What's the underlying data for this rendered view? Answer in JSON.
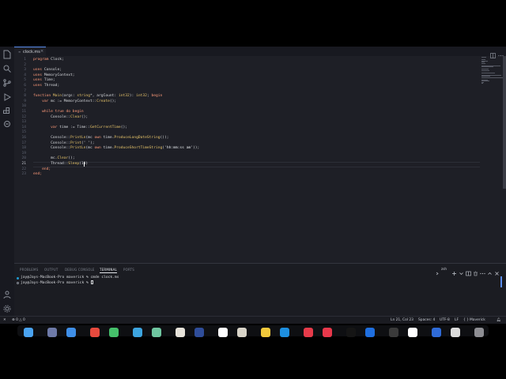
{
  "editor_tab": {
    "icon": "file-icon",
    "label": "clock.ms",
    "close": "×"
  },
  "code": {
    "line_numbers": [
      "1",
      "2",
      "3",
      "4",
      "5",
      "6",
      "7",
      "8",
      "9",
      "10",
      "11",
      "12",
      "13",
      "14",
      "15",
      "16",
      "17",
      "18",
      "19",
      "20",
      "21",
      "22",
      "23"
    ],
    "current_line": 21,
    "lines": [
      [
        {
          "t": "program ",
          "c": "kw"
        },
        {
          "t": "Clock;",
          "c": "pl"
        }
      ],
      [],
      [
        {
          "t": "uses ",
          "c": "kw"
        },
        {
          "t": "Console;",
          "c": "pl"
        }
      ],
      [
        {
          "t": "uses ",
          "c": "kw"
        },
        {
          "t": "MemoryContext;",
          "c": "pl"
        }
      ],
      [
        {
          "t": "uses ",
          "c": "kw"
        },
        {
          "t": "Time;",
          "c": "pl"
        }
      ],
      [
        {
          "t": "uses ",
          "c": "kw"
        },
        {
          "t": "Thread;",
          "c": "pl"
        }
      ],
      [],
      [
        {
          "t": "function ",
          "c": "kw"
        },
        {
          "t": "Main",
          "c": "fn"
        },
        {
          "t": "(args: ",
          "c": "pl"
        },
        {
          "t": "string",
          "c": "ty"
        },
        {
          "t": "*, argCount: ",
          "c": "pl"
        },
        {
          "t": "int32",
          "c": "ty"
        },
        {
          "t": "): ",
          "c": "pl"
        },
        {
          "t": "int32",
          "c": "ty"
        },
        {
          "t": "; ",
          "c": "pl"
        },
        {
          "t": "begin",
          "c": "kw"
        }
      ],
      [
        {
          "t": "    ",
          "c": "pl"
        },
        {
          "t": "var ",
          "c": "kw"
        },
        {
          "t": "mc := MemoryContext::",
          "c": "pl"
        },
        {
          "t": "Create",
          "c": "fn"
        },
        {
          "t": "();",
          "c": "pl"
        }
      ],
      [],
      [
        {
          "t": "    ",
          "c": "pl"
        },
        {
          "t": "while true do begin",
          "c": "kw"
        }
      ],
      [
        {
          "t": "        Console::",
          "c": "pl"
        },
        {
          "t": "Clear",
          "c": "fn"
        },
        {
          "t": "();",
          "c": "pl"
        }
      ],
      [],
      [
        {
          "t": "        ",
          "c": "pl"
        },
        {
          "t": "var ",
          "c": "kw"
        },
        {
          "t": "time := Time::",
          "c": "pl"
        },
        {
          "t": "GetCurrentTime",
          "c": "fn"
        },
        {
          "t": "();",
          "c": "pl"
        }
      ],
      [],
      [
        {
          "t": "        Console::",
          "c": "pl"
        },
        {
          "t": "PrintLn",
          "c": "fn"
        },
        {
          "t": "(mc ",
          "c": "pl"
        },
        {
          "t": "own ",
          "c": "kw"
        },
        {
          "t": "time.",
          "c": "pl"
        },
        {
          "t": "ProduceLongDateString",
          "c": "fn"
        },
        {
          "t": "());",
          "c": "pl"
        }
      ],
      [
        {
          "t": "        Console::",
          "c": "pl"
        },
        {
          "t": "Print",
          "c": "fn"
        },
        {
          "t": "(",
          "c": "pl"
        },
        {
          "t": "' '",
          "c": "st"
        },
        {
          "t": ");",
          "c": "pl"
        }
      ],
      [
        {
          "t": "        Console::",
          "c": "pl"
        },
        {
          "t": "PrintLn",
          "c": "fn"
        },
        {
          "t": "(mc ",
          "c": "pl"
        },
        {
          "t": "own ",
          "c": "kw"
        },
        {
          "t": "time.",
          "c": "pl"
        },
        {
          "t": "ProduceShortTimeString",
          "c": "fn"
        },
        {
          "t": "(",
          "c": "pl"
        },
        {
          "t": "'hh:mm:ss am'",
          "c": "st"
        },
        {
          "t": "));",
          "c": "pl"
        }
      ],
      [],
      [
        {
          "t": "        mc.",
          "c": "pl"
        },
        {
          "t": "Clear",
          "c": "fn"
        },
        {
          "t": "();",
          "c": "pl"
        }
      ],
      [
        {
          "t": "        Thread::",
          "c": "pl"
        },
        {
          "t": "Sleep",
          "c": "fn"
        },
        {
          "t": "(10)",
          "c": "pl"
        }
      ],
      [
        {
          "t": "    ",
          "c": "pl"
        },
        {
          "t": "end;",
          "c": "kw"
        }
      ],
      [
        {
          "t": "end;",
          "c": "kw"
        }
      ]
    ]
  },
  "panel": {
    "tabs": [
      "PROBLEMS",
      "OUTPUT",
      "DEBUG CONSOLE",
      "TERMINAL",
      "PORTS"
    ],
    "active_tab": "TERMINAL",
    "shell_label": "zsh",
    "terminal_lines": [
      "jay@Jays-MacBook-Pro maverick % cmde clock.ms",
      "jay@Jays-MacBook-Pro maverick % "
    ]
  },
  "status": {
    "errors": "0",
    "warnings": "0",
    "cursor_position": "Ln 21, Col 23",
    "spaces": "Spaces: 4",
    "encoding": "UTF-8",
    "eol": "LF",
    "braces": "{ }",
    "language": "Maverick"
  },
  "colors": {
    "accent": "#5a8dee",
    "keyword": "#ff9b7a",
    "function": "#e7c46a",
    "background": "#1e1f26"
  }
}
